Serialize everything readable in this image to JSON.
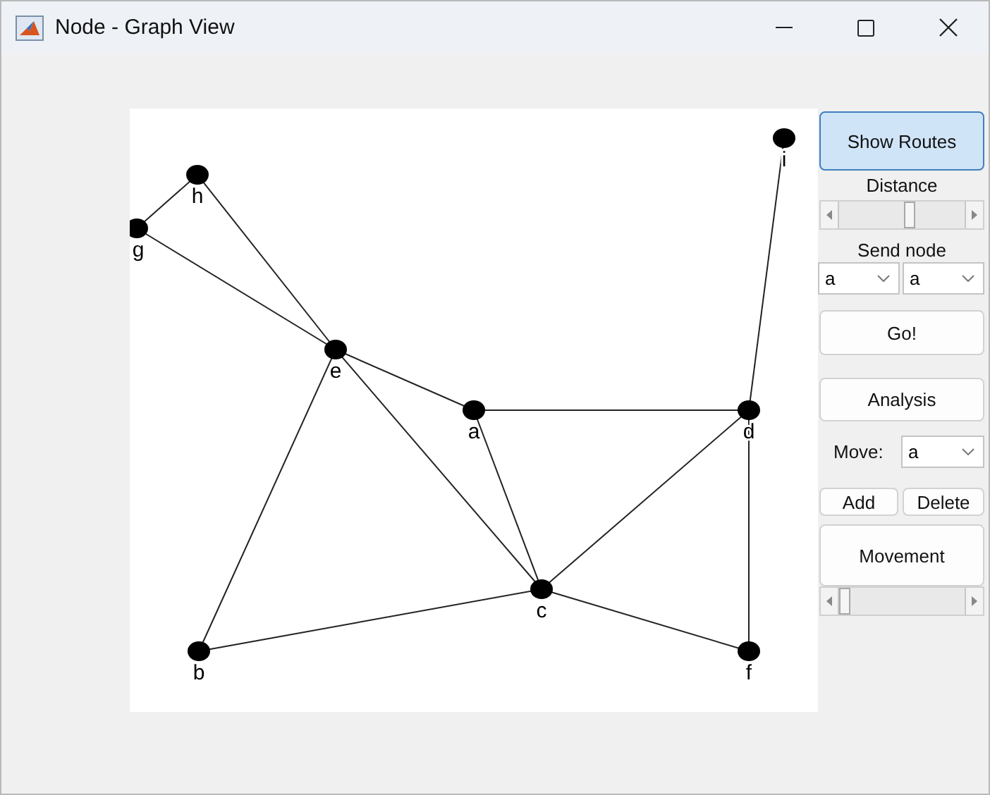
{
  "window": {
    "title": "Node - Graph View"
  },
  "graph": {
    "nodes": [
      {
        "label": "h"
      },
      {
        "label": "g"
      },
      {
        "label": "e"
      },
      {
        "label": "a"
      },
      {
        "label": "d"
      },
      {
        "label": "i"
      },
      {
        "label": "c"
      },
      {
        "label": "b"
      },
      {
        "label": "f"
      }
    ]
  },
  "panel": {
    "show_routes_button": {
      "label": "Show Routes",
      "pressed": true
    },
    "distance": {
      "label": "Distance",
      "level": 0.55
    },
    "send_node": {
      "label": "Send node",
      "from": "a",
      "to": "a"
    },
    "go_button": "Go!",
    "analysis_button": "Analysis",
    "move": {
      "label": "Move:",
      "value": "a"
    },
    "add_button": "Add",
    "delete_button": "Delete",
    "movement_button": "Movement",
    "movement_slider": {
      "level": 0
    }
  }
}
